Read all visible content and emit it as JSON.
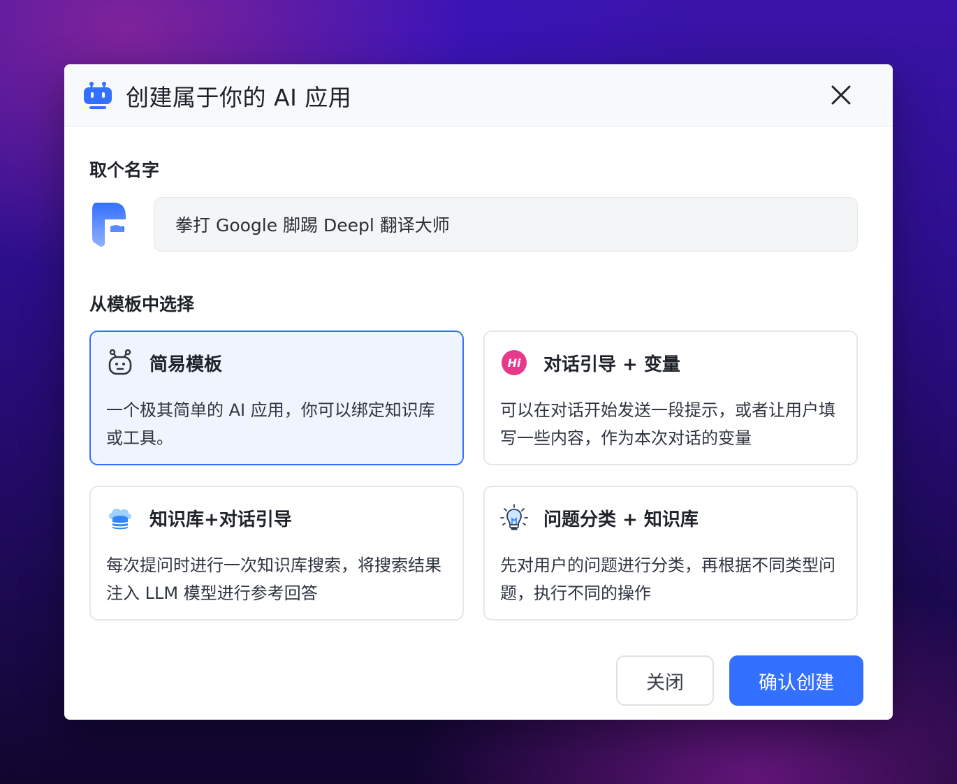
{
  "dialog": {
    "title": "创建属于你的 AI 应用",
    "icon": "robot-icon",
    "close_icon": "close-icon"
  },
  "name_section": {
    "label": "取个名字",
    "avatar_icon": "app-logo",
    "input_value": "拳打 Google 脚踢 Deepl 翻译大师"
  },
  "template_section": {
    "label": "从模板中选择",
    "templates": [
      {
        "title": "简易模板",
        "icon": "simple-robot-icon",
        "description": "一个极其简单的 AI 应用，你可以绑定知识库或工具。",
        "selected": true
      },
      {
        "title": "对话引导 + 变量",
        "icon": "hi-badge-icon",
        "description": "可以在对话开始发送一段提示，或者让用户填写一些内容，作为本次对话的变量",
        "selected": false
      },
      {
        "title": "知识库+对话引导",
        "icon": "database-cloud-icon",
        "description": "每次提问时进行一次知识库搜索，将搜索结果注入 LLM 模型进行参考回答",
        "selected": false
      },
      {
        "title": "问题分类 + 知识库",
        "icon": "lightbulb-icon",
        "description": "先对用户的问题进行分类，再根据不同类型问题，执行不同的操作",
        "selected": false
      }
    ]
  },
  "footer": {
    "close_label": "关闭",
    "confirm_label": "确认创建"
  },
  "colors": {
    "accent": "#3370ff",
    "selected_card_bg": "#eff4ff",
    "hi_badge": "#e8388a"
  }
}
